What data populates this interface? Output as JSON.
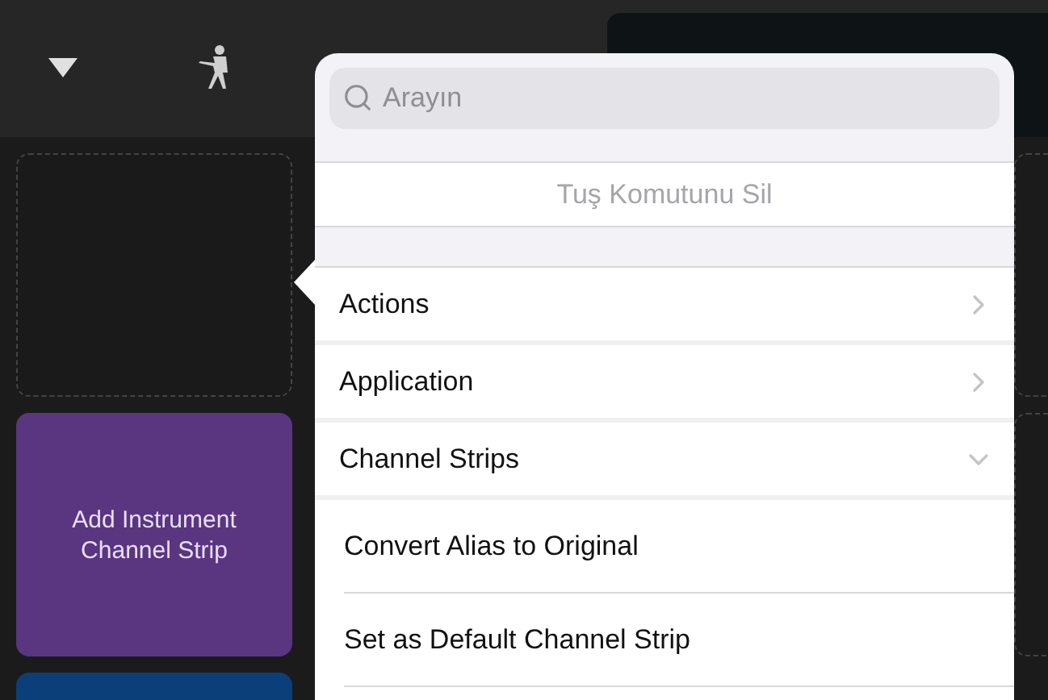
{
  "background": {
    "tiles": [
      {
        "kind": "empty"
      },
      {
        "kind": "add",
        "label": "Add Instrument Channel Strip",
        "color": "#5a3580"
      },
      {
        "kind": "add",
        "color": "#0a3f7a"
      }
    ]
  },
  "popover": {
    "search": {
      "placeholder": "Arayın"
    },
    "delete_command": {
      "label": "Tuş Komutunu Sil",
      "disabled": true
    },
    "categories": [
      {
        "label": "Actions",
        "expanded": false
      },
      {
        "label": "Application",
        "expanded": false
      },
      {
        "label": "Channel Strips",
        "expanded": true,
        "children": [
          {
            "label": "Convert Alias to Original"
          },
          {
            "label": "Set as Default Channel Strip"
          }
        ]
      }
    ]
  }
}
